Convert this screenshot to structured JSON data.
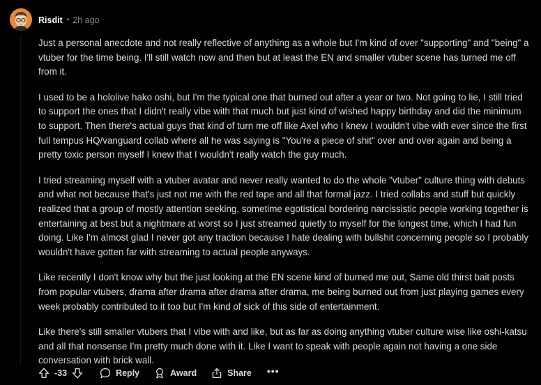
{
  "comment": {
    "username": "Risdit",
    "separator": "•",
    "timestamp": "2h ago",
    "paragraphs": [
      "Just a personal anecdote and not really reflective of anything as a whole but I'm kind of over \"supporting\" and \"being\" a vtuber for the time being. I'll still watch now and then but at least the EN and smaller vtuber scene has turned me off from it.",
      "I used to be a hololive hako oshi, but I'm the typical one that burned out after a year or two. Not going to lie, I still tried to support the ones that I didn't really vibe with that much but just kind of wished happy birthday and did the minimum to support. Then there's actual guys that kind of turn me off like Axel who I knew I wouldn't vibe with ever since the first full tempus HQ/vanguard collab where all he was saying is \"You're a piece of shit\" over and over again and being a pretty toxic person myself I knew that I wouldn't really watch the guy much.",
      "I tried streaming myself with a vtuber avatar and never really wanted to do the whole \"vtuber\" culture thing with debuts and what not because that's just not me with the red tape and all that formal jazz. I tried collabs and stuff but quickly realized that a group of mostly attention seeking, sometime egotistical bordering narcissistic people working together is entertaining at best but a nightmare at worst so I just streamed quietly to myself for the longest time, which I had fun doing. Like I'm almost glad I never got any traction because I hate dealing with bullshit concerning people so I probably wouldn't have gotten far with streaming to actual people anyways.",
      "Like recently I don't know why but the just looking at the EN scene kind of burned me out, Same old thirst bait posts from popular vtubers, drama after drama after drama after drama, me being burned out from just playing games every week probably contributed to it too but I'm kind of sick of this side of entertainment.",
      "Like there's still smaller vtubers that I vibe with and like, but as far as doing anything vtuber culture wise like oshi-katsu and all that nonsense I'm pretty much done with it. Like I want to speak with people again not having a one side conversation with brick wall."
    ]
  },
  "actions": {
    "score": "-33",
    "reply_label": "Reply",
    "award_label": "Award",
    "share_label": "Share",
    "more_label": "•••"
  },
  "icons": {
    "upvote": "upvote-arrow-icon",
    "downvote": "downvote-arrow-icon",
    "reply": "comment-bubble-icon",
    "award": "award-medal-icon",
    "share": "share-icon"
  },
  "colors": {
    "background": "#000000",
    "text": "#d7dadc",
    "muted": "#818384",
    "avatar": "#e8883a"
  }
}
